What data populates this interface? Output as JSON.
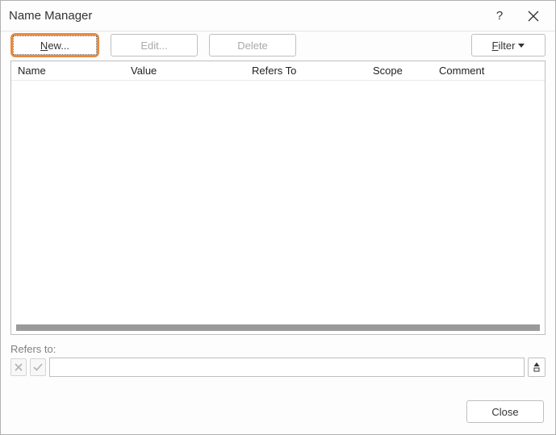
{
  "title": "Name Manager",
  "toolbar": {
    "new_prefix": "N",
    "new_suffix": "ew...",
    "edit_label": "Edit...",
    "delete_label": "Delete",
    "filter_prefix": "F",
    "filter_suffix": "ilter"
  },
  "grid": {
    "headers": {
      "name": "Name",
      "value": "Value",
      "refers": "Refers To",
      "scope": "Scope",
      "comment": "Comment"
    },
    "rows": []
  },
  "refers": {
    "label": "Refers to:",
    "value": ""
  },
  "footer": {
    "close_label": "Close"
  }
}
